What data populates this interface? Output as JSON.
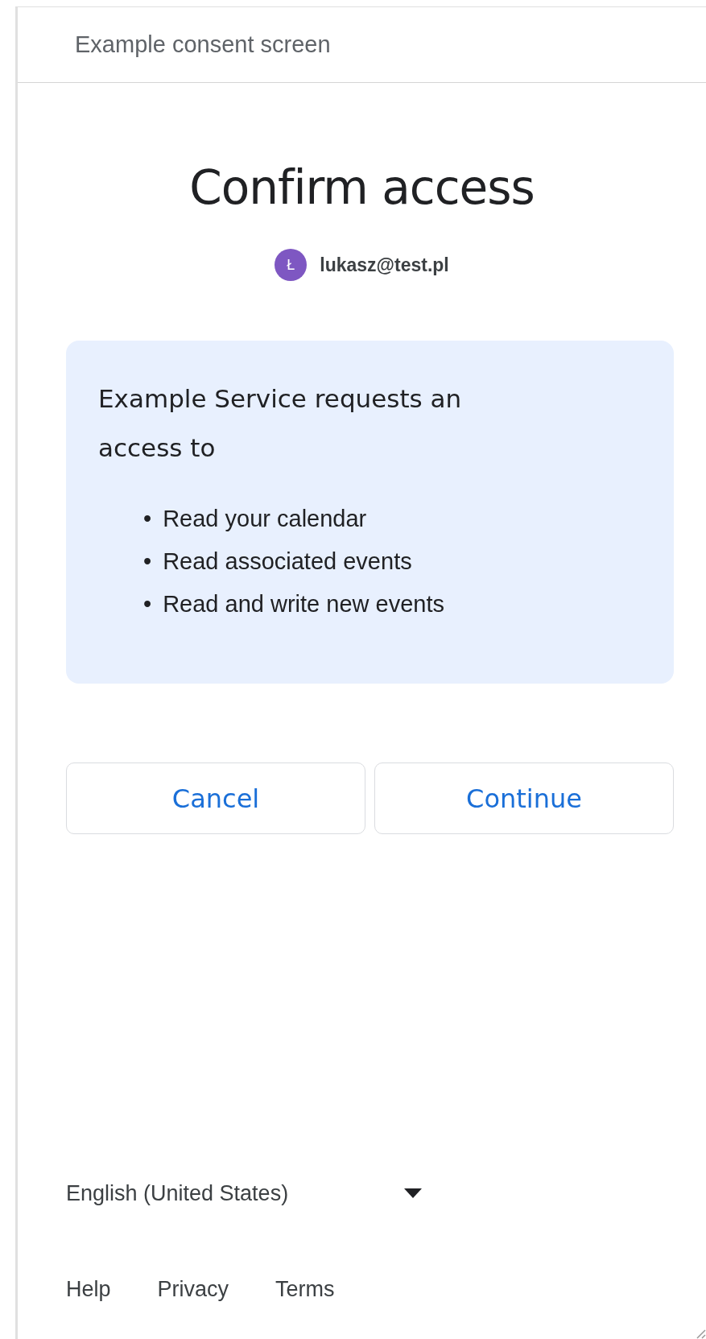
{
  "header": {
    "title": "Example consent screen"
  },
  "title": "Confirm access",
  "account": {
    "initial": "Ł",
    "email": "lukasz@test.pl",
    "color": "#7e57c2"
  },
  "request": {
    "heading": "Example Service requests an access to",
    "scopes": [
      {
        "bullet": "•",
        "text": "Read your calendar"
      },
      {
        "bullet": "•",
        "text": "Read associated events"
      },
      {
        "bullet": "•",
        "text": "Read and write new events"
      }
    ]
  },
  "buttons": [
    {
      "label": "Cancel"
    },
    {
      "label": "Continue"
    }
  ],
  "language": {
    "value": "English (United States)"
  },
  "footer_links": [
    "Help",
    "Privacy",
    "Terms"
  ]
}
